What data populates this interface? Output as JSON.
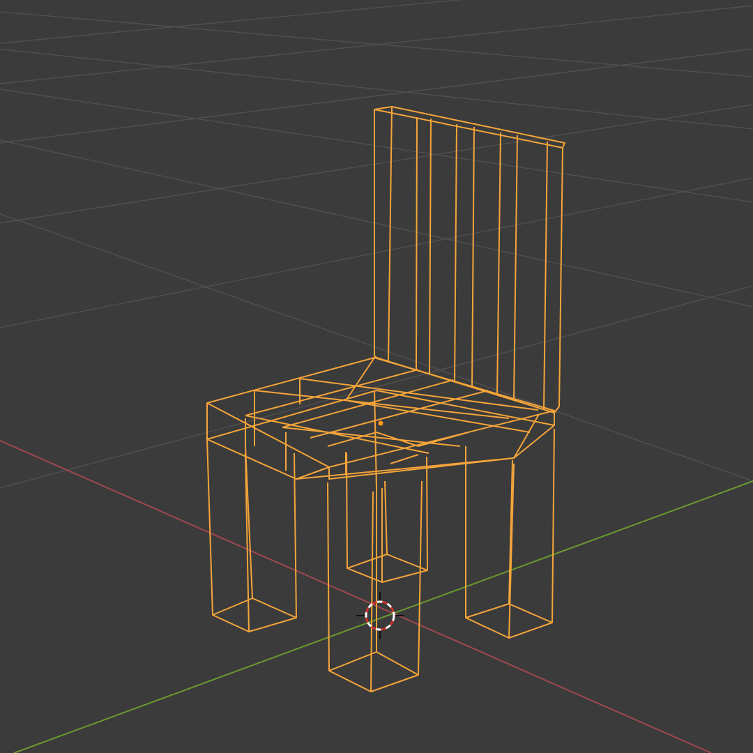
{
  "viewport": {
    "mode": "wireframe",
    "background_color": "#3b3b3b",
    "grid_color": "#4f4f4f",
    "x_axis_color": "#a0484f",
    "y_axis_color": "#6a9a2f"
  },
  "object": {
    "name": "chair",
    "selected": true,
    "wire_color": "#f5a53a",
    "origin_color": "#ff9a1a"
  },
  "cursor": {
    "icon": "3d-cursor-icon",
    "ring_colors": [
      "#ffffff",
      "#d0302a"
    ]
  }
}
